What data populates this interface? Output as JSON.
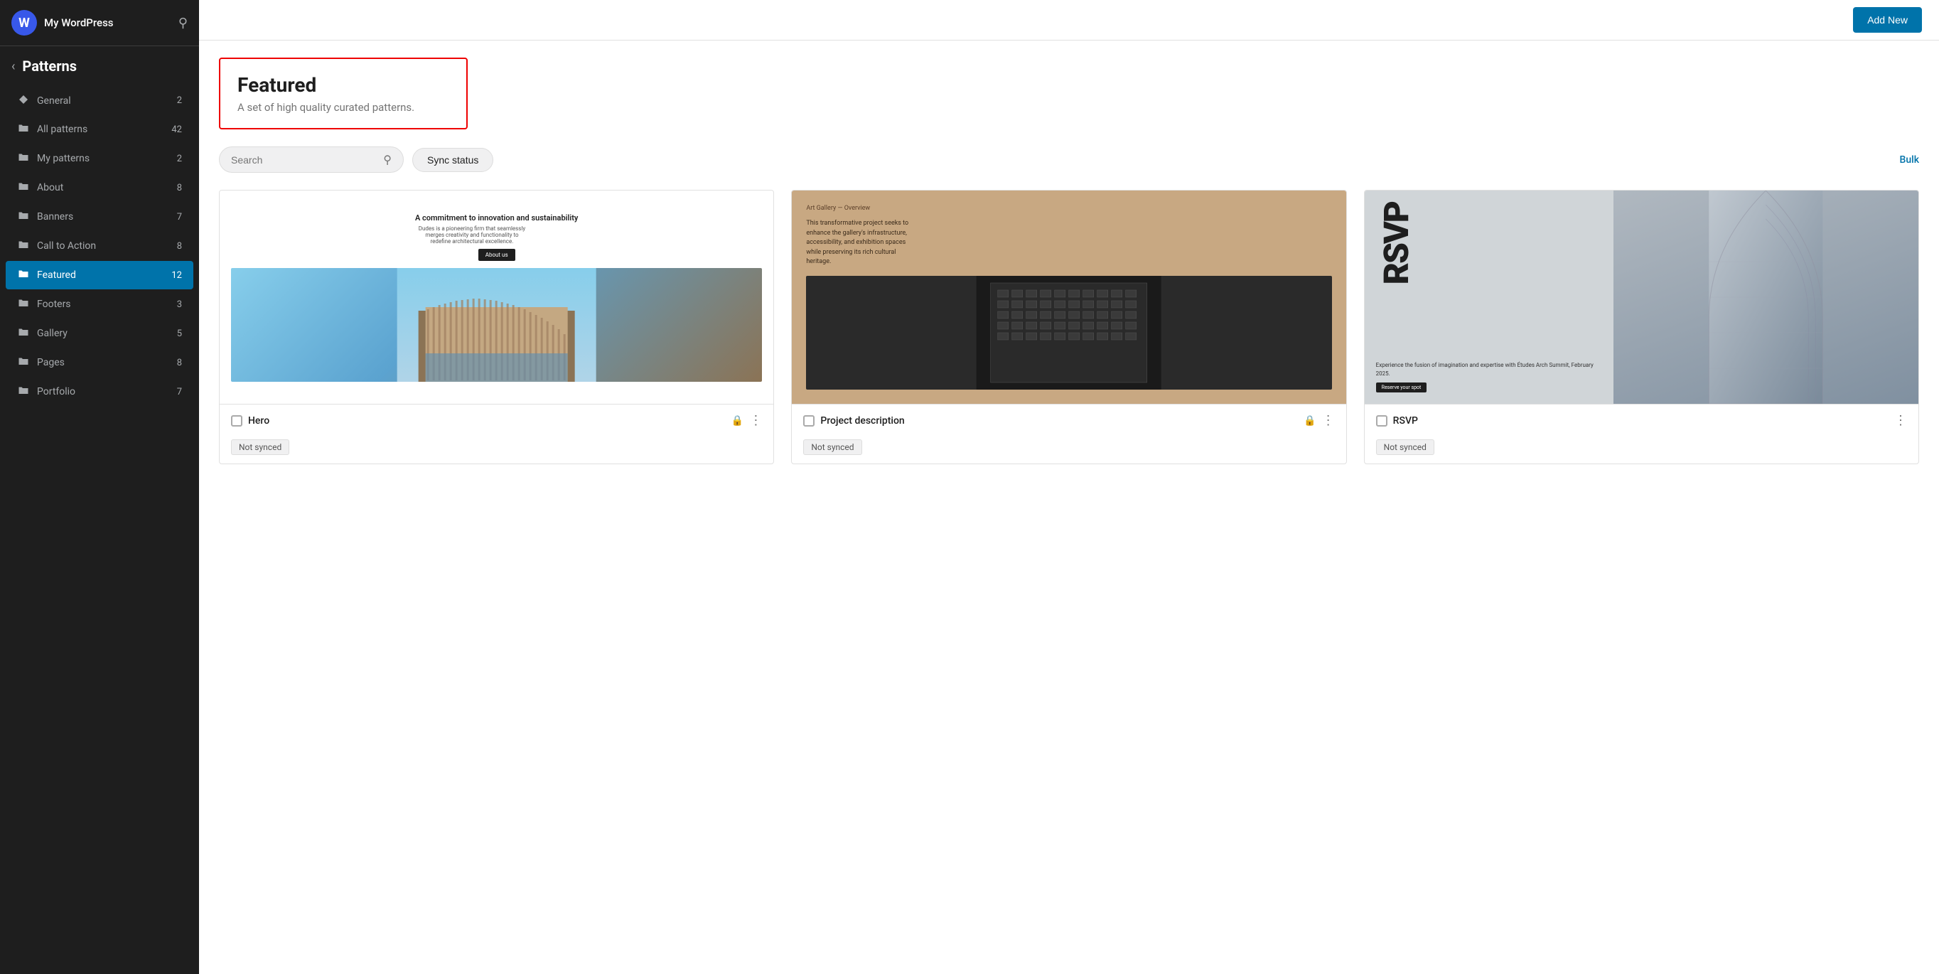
{
  "sidebar": {
    "logo_letter": "W",
    "site_name": "My WordPress",
    "back_label": "‹",
    "section_title": "Patterns",
    "nav_items": [
      {
        "id": "general",
        "icon": "diamond",
        "label": "General",
        "count": "2",
        "active": false
      },
      {
        "id": "all-patterns",
        "icon": "folder",
        "label": "All patterns",
        "count": "42",
        "active": false
      },
      {
        "id": "my-patterns",
        "icon": "folder",
        "label": "My patterns",
        "count": "2",
        "active": false
      },
      {
        "id": "about",
        "icon": "folder",
        "label": "About",
        "count": "8",
        "active": false
      },
      {
        "id": "banners",
        "icon": "folder",
        "label": "Banners",
        "count": "7",
        "active": false
      },
      {
        "id": "call-to-action",
        "icon": "folder",
        "label": "Call to Action",
        "count": "8",
        "active": false
      },
      {
        "id": "featured",
        "icon": "folder",
        "label": "Featured",
        "count": "12",
        "active": true
      },
      {
        "id": "footers",
        "icon": "folder",
        "label": "Footers",
        "count": "3",
        "active": false
      },
      {
        "id": "gallery",
        "icon": "folder",
        "label": "Gallery",
        "count": "5",
        "active": false
      },
      {
        "id": "pages",
        "icon": "folder",
        "label": "Pages",
        "count": "8",
        "active": false
      },
      {
        "id": "portfolio",
        "icon": "folder",
        "label": "Portfolio",
        "count": "7",
        "active": false
      }
    ]
  },
  "topbar": {
    "add_new_label": "Add New"
  },
  "content": {
    "featured_title": "Featured",
    "featured_description": "A set of high quality curated patterns.",
    "search_placeholder": "Search",
    "sync_status_label": "Sync status",
    "bulk_action_label": "Bulk",
    "patterns": [
      {
        "id": "hero",
        "name": "Hero",
        "sync_status": "Not synced",
        "locked": true,
        "preview_type": "hero"
      },
      {
        "id": "project-description",
        "name": "Project description",
        "sync_status": "Not synced",
        "locked": true,
        "preview_type": "project"
      },
      {
        "id": "rsvp",
        "name": "RSVP",
        "sync_status": "Not synced",
        "locked": false,
        "preview_type": "rsvp"
      }
    ],
    "hero_preview": {
      "heading": "A commitment to innovation and sustainability",
      "body": "Dudes is a pioneering firm that seamlessly merges creativity and functionality to redefine architectural excellence.",
      "button": "About us"
    },
    "project_preview": {
      "label": "Art Gallery — Overview",
      "description": "This transformative project seeks to enhance the gallery's infrastructure, accessibility, and exhibition spaces while preserving its rich cultural heritage."
    },
    "rsvp_preview": {
      "text": "RSVP",
      "body": "Experience the fusion of imagination and expertise with Études Arch Summit, February 2025.",
      "cta": "Reserve your spot"
    }
  }
}
